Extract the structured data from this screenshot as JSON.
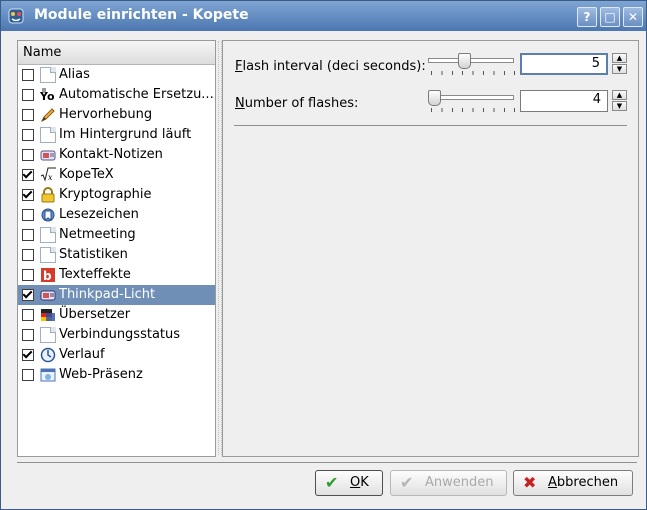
{
  "window": {
    "title": "Module einrichten - Kopete",
    "help": "?",
    "maximize": "□",
    "close": "✕"
  },
  "plugin_list": {
    "header": "Name",
    "items": [
      {
        "label": "Alias",
        "checked": false,
        "icon": "document-icon"
      },
      {
        "label": "Automatische Ersetzu...",
        "checked": false,
        "icon": "autoreplace-icon"
      },
      {
        "label": "Hervorhebung",
        "checked": false,
        "icon": "highlight-pencil-icon"
      },
      {
        "label": "Im Hintergrund läuft",
        "checked": false,
        "icon": "document-icon"
      },
      {
        "label": "Kontakt-Notizen",
        "checked": false,
        "icon": "contact-notes-icon"
      },
      {
        "label": "KopeTeX",
        "checked": true,
        "icon": "latex-sqrt-icon"
      },
      {
        "label": "Kryptographie",
        "checked": true,
        "icon": "padlock-icon"
      },
      {
        "label": "Lesezeichen",
        "checked": false,
        "icon": "bookmarks-icon"
      },
      {
        "label": "Netmeeting",
        "checked": false,
        "icon": "document-icon"
      },
      {
        "label": "Statistiken",
        "checked": false,
        "icon": "document-icon"
      },
      {
        "label": "Texteffekte",
        "checked": false,
        "icon": "text-effects-icon"
      },
      {
        "label": "Thinkpad-Licht",
        "checked": true,
        "icon": "thinkpad-light-icon",
        "selected": true
      },
      {
        "label": "Übersetzer",
        "checked": false,
        "icon": "translator-icon"
      },
      {
        "label": "Verbindungsstatus",
        "checked": false,
        "icon": "document-icon"
      },
      {
        "label": "Verlauf",
        "checked": true,
        "icon": "history-clock-icon"
      },
      {
        "label": "Web-Präsenz",
        "checked": false,
        "icon": "web-presence-icon"
      }
    ]
  },
  "settings": {
    "flash_interval": {
      "label_mnemonic": "F",
      "label_rest": "lash interval (deci seconds):",
      "value": "5",
      "slider_fraction": 0.4
    },
    "number_of_flashes": {
      "label_mnemonic": "N",
      "label_rest": "umber of flashes:",
      "value": "4",
      "slider_fraction": 0.0
    }
  },
  "buttons": {
    "ok": {
      "mnemonic": "O",
      "rest": "K"
    },
    "apply": {
      "label": "Anwenden",
      "enabled": false
    },
    "cancel": {
      "mnemonic": "A",
      "rest": "bbrechen"
    }
  },
  "colors": {
    "titlebar": "#4c77b0",
    "selection": "#6f8fb7",
    "focus": "#5b7fb0",
    "ok_check": "#2e9b2e",
    "cancel_x": "#c62121"
  }
}
